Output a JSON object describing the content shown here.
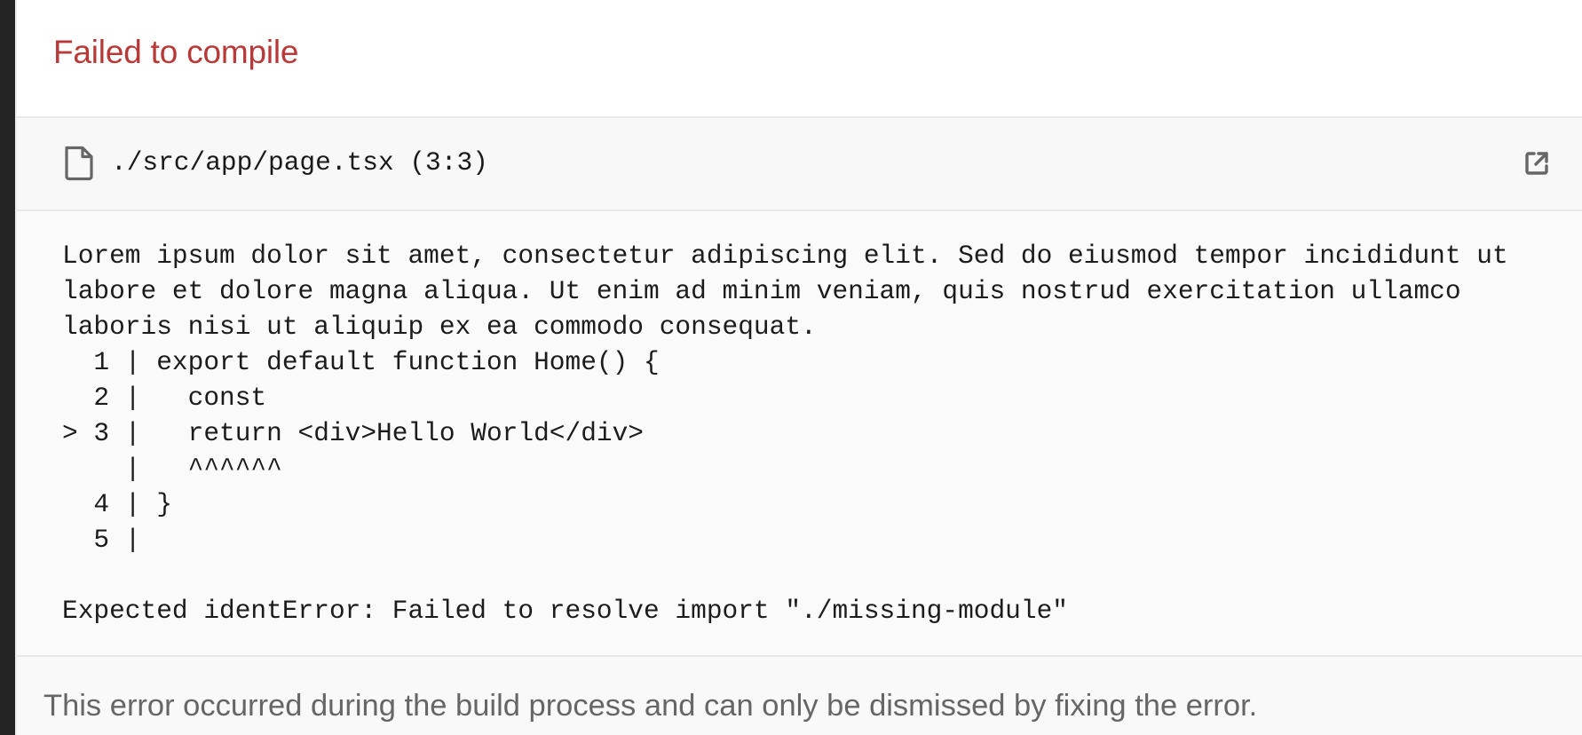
{
  "overlay": {
    "title": "Failed to compile",
    "title_color": "#b83a38"
  },
  "file": {
    "icon": "file-icon",
    "path": "./src/app/page.tsx (3:3)",
    "open_in_editor_icon": "external-link-icon"
  },
  "code_frame": {
    "lines": [
      "Lorem ipsum dolor sit amet, consectetur adipiscing elit. Sed do eiusmod tempor incididunt ut",
      "labore et dolore magna aliqua. Ut enim ad minim veniam, quis nostrud exercitation ullamco",
      "laboris nisi ut aliquip ex ea commodo consequat.",
      "  1 | export default function Home() {",
      "  2 |   const",
      "> 3 |   return <div>Hello World</div>",
      "    |   ^^^^^^",
      "  4 | }",
      "  5 |",
      "",
      "Expected identError: Failed to resolve import \"./missing-module\""
    ]
  },
  "footer": {
    "message": "This error occurred during the build process and can only be dismissed by fixing the error."
  }
}
